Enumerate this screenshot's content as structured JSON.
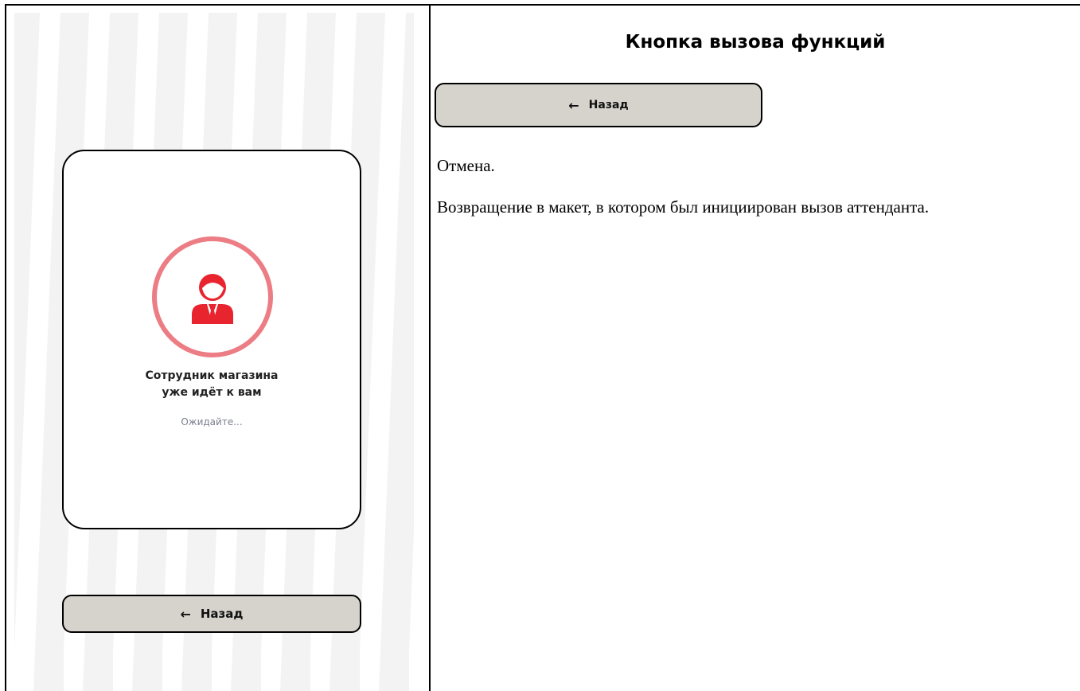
{
  "mockup": {
    "dialog_title_line1": "Сотрудник магазина",
    "dialog_title_line2": "уже идёт к вам",
    "dialog_status": "Ожидайте...",
    "back_button": "Назад",
    "icon": "attendant-person-icon",
    "colors": {
      "ring": "#ec7d84",
      "icon": "#e8242f",
      "button": "#d6d3cc"
    }
  },
  "description": {
    "heading": "Кнопка вызова функций",
    "button_label": "Назад",
    "action": "Отмена.",
    "text": "Возвращение в макет, в котором был инициирован вызов аттенданта."
  }
}
